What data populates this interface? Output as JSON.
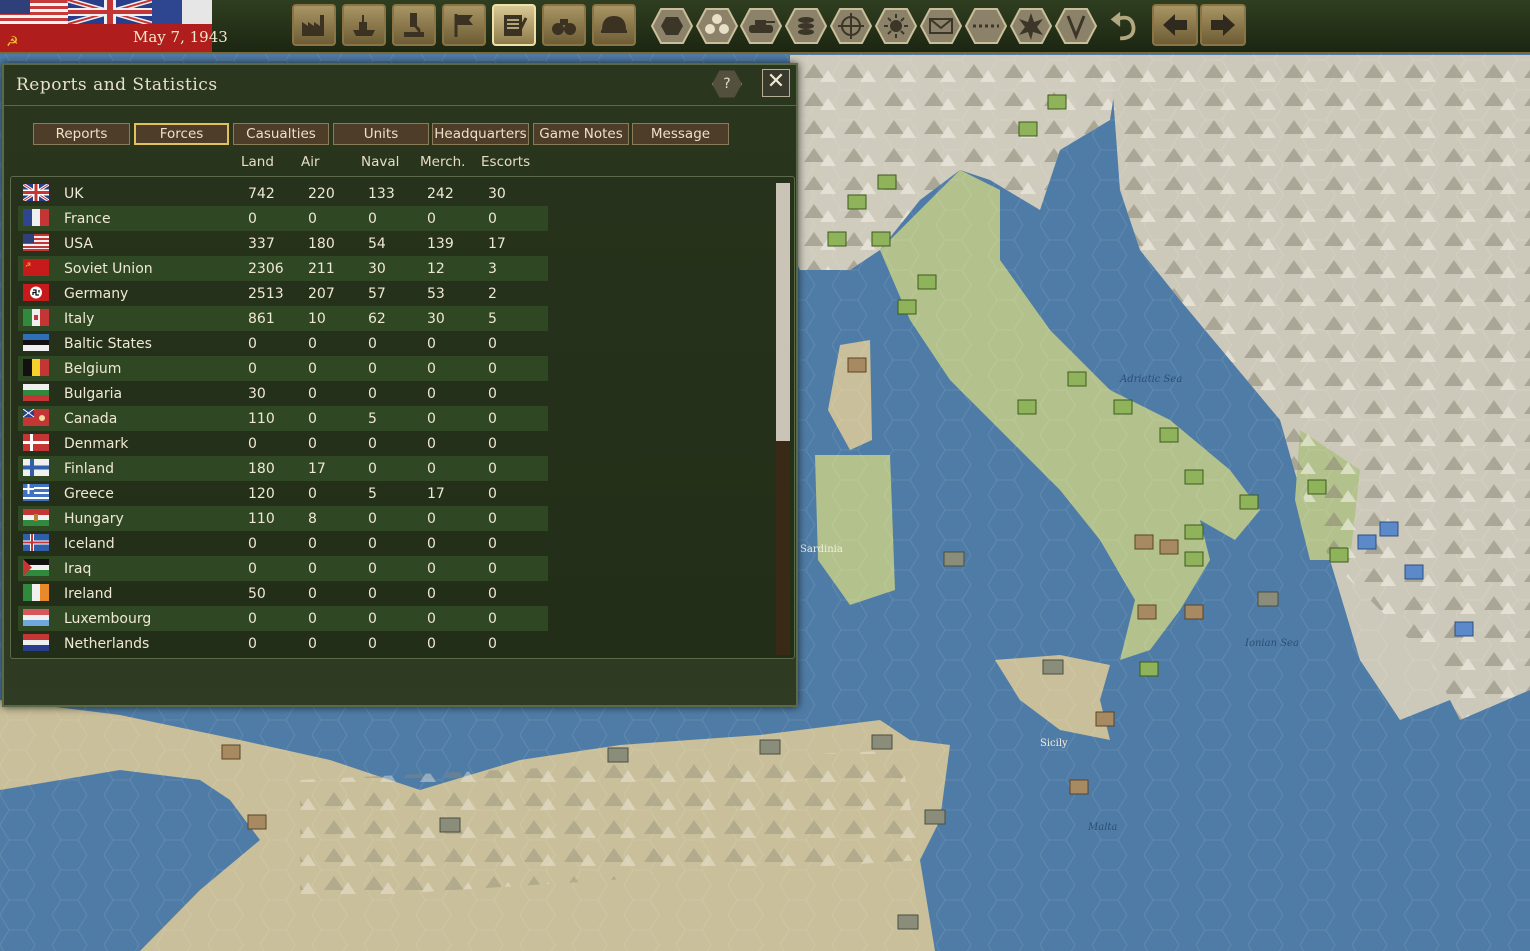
{
  "topbar": {
    "date": "May 7, 1943",
    "buttons": [
      "factory-icon",
      "warship-icon",
      "microscope-icon",
      "flag-icon",
      "reports-icon",
      "binoculars-icon",
      "helmet-icon"
    ],
    "hex_buttons": [
      "hex-icon",
      "hexgrid-icon",
      "tank-icon",
      "coins-icon",
      "crosshair-icon",
      "sun-icon",
      "envelope-icon",
      "dotted-line-icon",
      "explosion-icon",
      "victory-icon"
    ],
    "undo": "undo-icon",
    "prev": "arrow-left-icon",
    "next": "arrow-right-icon"
  },
  "panel": {
    "title": "Reports and Statistics",
    "help_label": "?",
    "close_label": "✕",
    "tabs": [
      "Reports",
      "Forces",
      "Casualties",
      "Units",
      "Headquarters",
      "Game Notes",
      "Message"
    ],
    "selected_tab": "Forces",
    "columns": [
      "Land",
      "Air",
      "Naval",
      "Merch.",
      "Escorts"
    ],
    "rows": [
      {
        "flag": "uk",
        "country": "UK",
        "land": "742",
        "air": "220",
        "naval": "133",
        "merch": "242",
        "escorts": "30"
      },
      {
        "flag": "france",
        "country": "France",
        "land": "0",
        "air": "0",
        "naval": "0",
        "merch": "0",
        "escorts": "0"
      },
      {
        "flag": "usa",
        "country": "USA",
        "land": "337",
        "air": "180",
        "naval": "54",
        "merch": "139",
        "escorts": "17"
      },
      {
        "flag": "soviet",
        "country": "Soviet Union",
        "land": "2306",
        "air": "211",
        "naval": "30",
        "merch": "12",
        "escorts": "3"
      },
      {
        "flag": "germany",
        "country": "Germany",
        "land": "2513",
        "air": "207",
        "naval": "57",
        "merch": "53",
        "escorts": "2"
      },
      {
        "flag": "italy",
        "country": "Italy",
        "land": "861",
        "air": "10",
        "naval": "62",
        "merch": "30",
        "escorts": "5"
      },
      {
        "flag": "baltic",
        "country": "Baltic States",
        "land": "0",
        "air": "0",
        "naval": "0",
        "merch": "0",
        "escorts": "0"
      },
      {
        "flag": "belgium",
        "country": "Belgium",
        "land": "0",
        "air": "0",
        "naval": "0",
        "merch": "0",
        "escorts": "0"
      },
      {
        "flag": "bulgaria",
        "country": "Bulgaria",
        "land": "30",
        "air": "0",
        "naval": "0",
        "merch": "0",
        "escorts": "0"
      },
      {
        "flag": "canada",
        "country": "Canada",
        "land": "110",
        "air": "0",
        "naval": "5",
        "merch": "0",
        "escorts": "0"
      },
      {
        "flag": "denmark",
        "country": "Denmark",
        "land": "0",
        "air": "0",
        "naval": "0",
        "merch": "0",
        "escorts": "0"
      },
      {
        "flag": "finland",
        "country": "Finland",
        "land": "180",
        "air": "17",
        "naval": "0",
        "merch": "0",
        "escorts": "0"
      },
      {
        "flag": "greece",
        "country": "Greece",
        "land": "120",
        "air": "0",
        "naval": "5",
        "merch": "17",
        "escorts": "0"
      },
      {
        "flag": "hungary",
        "country": "Hungary",
        "land": "110",
        "air": "8",
        "naval": "0",
        "merch": "0",
        "escorts": "0"
      },
      {
        "flag": "iceland",
        "country": "Iceland",
        "land": "0",
        "air": "0",
        "naval": "0",
        "merch": "0",
        "escorts": "0"
      },
      {
        "flag": "iraq",
        "country": "Iraq",
        "land": "0",
        "air": "0",
        "naval": "0",
        "merch": "0",
        "escorts": "0"
      },
      {
        "flag": "ireland",
        "country": "Ireland",
        "land": "50",
        "air": "0",
        "naval": "0",
        "merch": "0",
        "escorts": "0"
      },
      {
        "flag": "luxembourg",
        "country": "Luxembourg",
        "land": "0",
        "air": "0",
        "naval": "0",
        "merch": "0",
        "escorts": "0"
      },
      {
        "flag": "netherlands",
        "country": "Netherlands",
        "land": "0",
        "air": "0",
        "naval": "0",
        "merch": "0",
        "escorts": "0"
      }
    ]
  },
  "map": {
    "labels": {
      "adriatic": "Adriatic Sea",
      "ionian": "Ionian Sea",
      "sicily": "Sicily",
      "malta": "Malta",
      "sardinia": "Sardinia"
    },
    "colors": {
      "sea": "#4f7ca6",
      "land": "#c9bf9a",
      "green_land": "#a9bd85"
    }
  }
}
